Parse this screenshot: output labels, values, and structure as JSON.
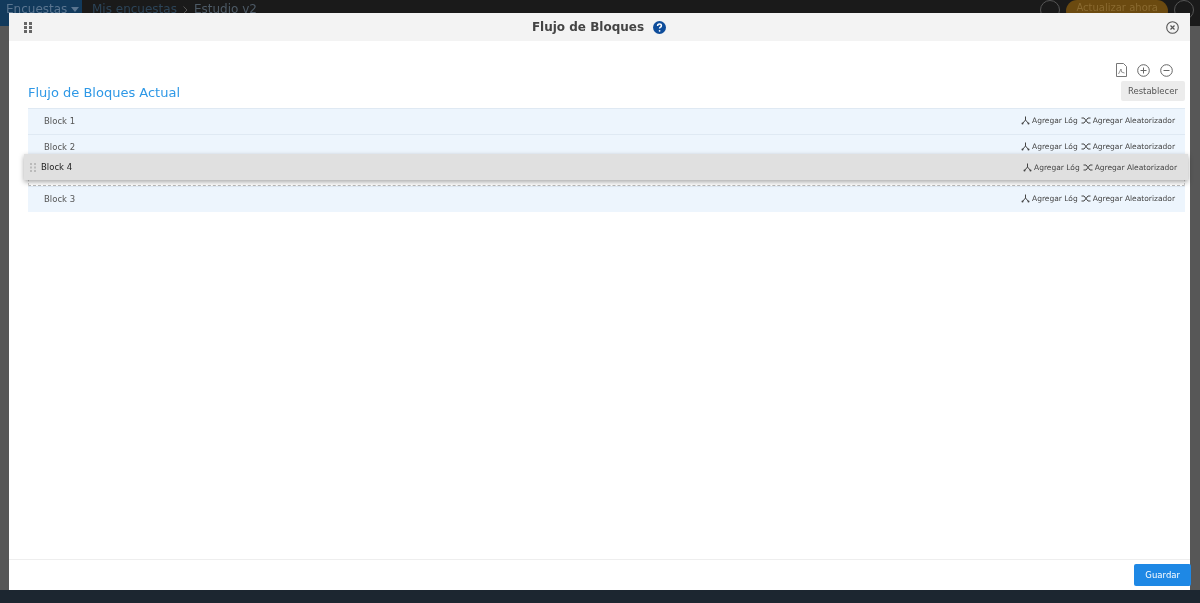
{
  "app_bar": {
    "menu": "Encuestas",
    "breadcrumbs": [
      "Mis encuestas",
      "Estudio v2"
    ],
    "upgrade": "Actualizar ahora"
  },
  "dialog": {
    "title": "Flujo de Bloques",
    "heading": "Flujo de Bloques Actual",
    "reset": "Restablecer",
    "save": "Guardar"
  },
  "blocks": [
    {
      "label": "Block 1",
      "logic": "Agregar Lóg",
      "randomizer": "Agregar Aleatorizador"
    },
    {
      "label": "Block 2",
      "logic": "Agregar Lóg",
      "randomizer": "Agregar Aleatorizador"
    },
    {
      "kind": "drop-placeholder"
    },
    {
      "label": "Block 3",
      "logic": "Agregar Lóg",
      "randomizer": "Agregar Aleatorizador"
    }
  ],
  "dragged_block": {
    "label": "Block 4",
    "logic": "Agregar Lóg",
    "randomizer": "Agregar Aleatorizador"
  }
}
